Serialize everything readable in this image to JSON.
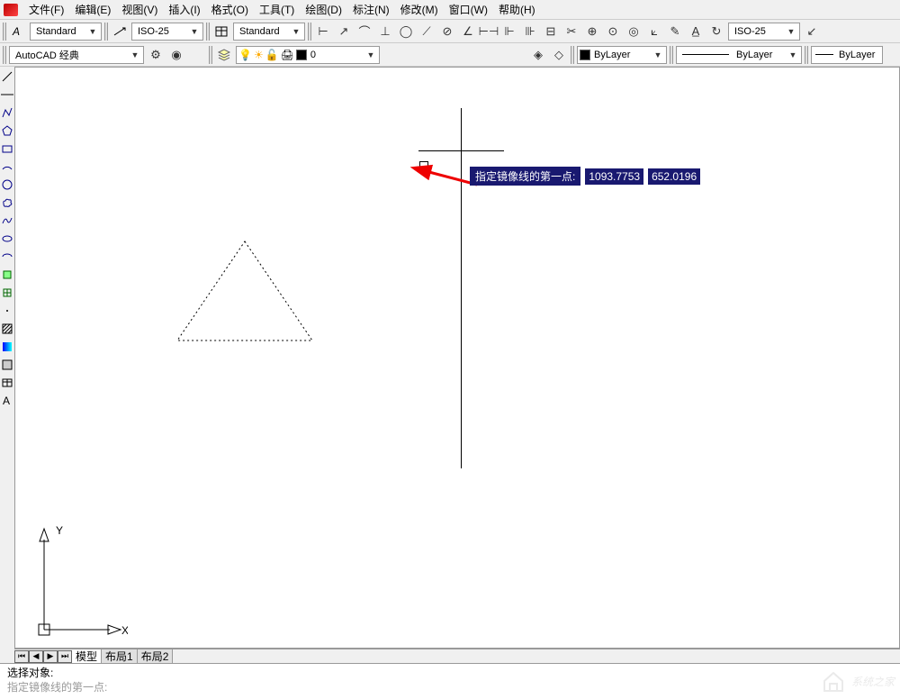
{
  "menu": {
    "items": [
      "文件(F)",
      "编辑(E)",
      "视图(V)",
      "插入(I)",
      "格式(O)",
      "工具(T)",
      "绘图(D)",
      "标注(N)",
      "修改(M)",
      "窗口(W)",
      "帮助(H)"
    ]
  },
  "toolbar1": {
    "style_left": "Standard",
    "dim_style": "ISO-25",
    "style_right": "Standard",
    "dim_style2": "ISO-25"
  },
  "toolbar2": {
    "workspace": "AutoCAD 经典",
    "layer": "0",
    "bylayer1": "ByLayer",
    "bylayer2": "ByLayer",
    "bylayer3": "ByLayer"
  },
  "canvas": {
    "tooltip_label": "指定镜像线的第一点:",
    "coord_x": "1093.7753",
    "coord_y": "652.0196",
    "ucs_y": "Y",
    "ucs_x": "X"
  },
  "tabs": {
    "model": "模型",
    "layout1": "布局1",
    "layout2": "布局2"
  },
  "command": {
    "line1": "选择对象:",
    "line2": "指定镜像线的第一点:"
  },
  "watermark": "系统之家"
}
